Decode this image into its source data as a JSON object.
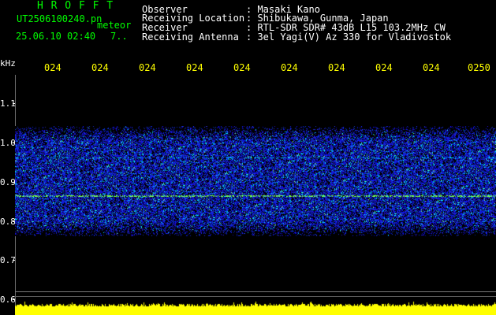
{
  "brand": "H R O F F T",
  "file_name": "UT2506100240.pn",
  "tag": "meteor",
  "datetime": "25.06.10 02:40",
  "seven_label": "7..",
  "header": [
    {
      "label": "Observer",
      "value": ": Masaki Kano"
    },
    {
      "label": "Receiving Location",
      "value": ": Shibukawa, Gunma, Japan"
    },
    {
      "label": "Receiver",
      "value": ": RTL-SDR SDR# 43dB L15 103.2MHz CW"
    },
    {
      "label": "Receiving Antenna",
      "value": ": 3el Yagi(V) Az 330 for Vladivostok"
    }
  ],
  "axis": {
    "unit": "kHz",
    "y_ticks": [
      "1.1",
      "1.0",
      "0.9",
      "0.8",
      "0.7",
      "0.6"
    ],
    "x_ticks": [
      "024",
      "024",
      "024",
      "024",
      "024",
      "024",
      "024",
      "024",
      "024",
      "0250"
    ]
  },
  "colors": {
    "background": "#000000",
    "text_green": "#00ff00",
    "text_yellow": "#ffff00",
    "noise_blue": "#1a26ff",
    "noise_cyan": "#00e5ff",
    "signal_bar": "#ffff00"
  }
}
